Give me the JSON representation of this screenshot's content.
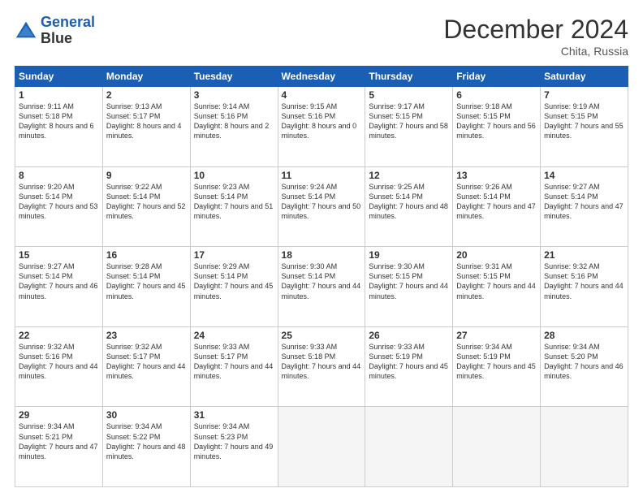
{
  "header": {
    "logo_line1": "General",
    "logo_line2": "Blue",
    "month": "December 2024",
    "location": "Chita, Russia"
  },
  "weekdays": [
    "Sunday",
    "Monday",
    "Tuesday",
    "Wednesday",
    "Thursday",
    "Friday",
    "Saturday"
  ],
  "weeks": [
    [
      {
        "day": "1",
        "sunrise": "Sunrise: 9:11 AM",
        "sunset": "Sunset: 5:18 PM",
        "daylight": "Daylight: 8 hours and 6 minutes."
      },
      {
        "day": "2",
        "sunrise": "Sunrise: 9:13 AM",
        "sunset": "Sunset: 5:17 PM",
        "daylight": "Daylight: 8 hours and 4 minutes."
      },
      {
        "day": "3",
        "sunrise": "Sunrise: 9:14 AM",
        "sunset": "Sunset: 5:16 PM",
        "daylight": "Daylight: 8 hours and 2 minutes."
      },
      {
        "day": "4",
        "sunrise": "Sunrise: 9:15 AM",
        "sunset": "Sunset: 5:16 PM",
        "daylight": "Daylight: 8 hours and 0 minutes."
      },
      {
        "day": "5",
        "sunrise": "Sunrise: 9:17 AM",
        "sunset": "Sunset: 5:15 PM",
        "daylight": "Daylight: 7 hours and 58 minutes."
      },
      {
        "day": "6",
        "sunrise": "Sunrise: 9:18 AM",
        "sunset": "Sunset: 5:15 PM",
        "daylight": "Daylight: 7 hours and 56 minutes."
      },
      {
        "day": "7",
        "sunrise": "Sunrise: 9:19 AM",
        "sunset": "Sunset: 5:15 PM",
        "daylight": "Daylight: 7 hours and 55 minutes."
      }
    ],
    [
      {
        "day": "8",
        "sunrise": "Sunrise: 9:20 AM",
        "sunset": "Sunset: 5:14 PM",
        "daylight": "Daylight: 7 hours and 53 minutes."
      },
      {
        "day": "9",
        "sunrise": "Sunrise: 9:22 AM",
        "sunset": "Sunset: 5:14 PM",
        "daylight": "Daylight: 7 hours and 52 minutes."
      },
      {
        "day": "10",
        "sunrise": "Sunrise: 9:23 AM",
        "sunset": "Sunset: 5:14 PM",
        "daylight": "Daylight: 7 hours and 51 minutes."
      },
      {
        "day": "11",
        "sunrise": "Sunrise: 9:24 AM",
        "sunset": "Sunset: 5:14 PM",
        "daylight": "Daylight: 7 hours and 50 minutes."
      },
      {
        "day": "12",
        "sunrise": "Sunrise: 9:25 AM",
        "sunset": "Sunset: 5:14 PM",
        "daylight": "Daylight: 7 hours and 48 minutes."
      },
      {
        "day": "13",
        "sunrise": "Sunrise: 9:26 AM",
        "sunset": "Sunset: 5:14 PM",
        "daylight": "Daylight: 7 hours and 47 minutes."
      },
      {
        "day": "14",
        "sunrise": "Sunrise: 9:27 AM",
        "sunset": "Sunset: 5:14 PM",
        "daylight": "Daylight: 7 hours and 47 minutes."
      }
    ],
    [
      {
        "day": "15",
        "sunrise": "Sunrise: 9:27 AM",
        "sunset": "Sunset: 5:14 PM",
        "daylight": "Daylight: 7 hours and 46 minutes."
      },
      {
        "day": "16",
        "sunrise": "Sunrise: 9:28 AM",
        "sunset": "Sunset: 5:14 PM",
        "daylight": "Daylight: 7 hours and 45 minutes."
      },
      {
        "day": "17",
        "sunrise": "Sunrise: 9:29 AM",
        "sunset": "Sunset: 5:14 PM",
        "daylight": "Daylight: 7 hours and 45 minutes."
      },
      {
        "day": "18",
        "sunrise": "Sunrise: 9:30 AM",
        "sunset": "Sunset: 5:14 PM",
        "daylight": "Daylight: 7 hours and 44 minutes."
      },
      {
        "day": "19",
        "sunrise": "Sunrise: 9:30 AM",
        "sunset": "Sunset: 5:15 PM",
        "daylight": "Daylight: 7 hours and 44 minutes."
      },
      {
        "day": "20",
        "sunrise": "Sunrise: 9:31 AM",
        "sunset": "Sunset: 5:15 PM",
        "daylight": "Daylight: 7 hours and 44 minutes."
      },
      {
        "day": "21",
        "sunrise": "Sunrise: 9:32 AM",
        "sunset": "Sunset: 5:16 PM",
        "daylight": "Daylight: 7 hours and 44 minutes."
      }
    ],
    [
      {
        "day": "22",
        "sunrise": "Sunrise: 9:32 AM",
        "sunset": "Sunset: 5:16 PM",
        "daylight": "Daylight: 7 hours and 44 minutes."
      },
      {
        "day": "23",
        "sunrise": "Sunrise: 9:32 AM",
        "sunset": "Sunset: 5:17 PM",
        "daylight": "Daylight: 7 hours and 44 minutes."
      },
      {
        "day": "24",
        "sunrise": "Sunrise: 9:33 AM",
        "sunset": "Sunset: 5:17 PM",
        "daylight": "Daylight: 7 hours and 44 minutes."
      },
      {
        "day": "25",
        "sunrise": "Sunrise: 9:33 AM",
        "sunset": "Sunset: 5:18 PM",
        "daylight": "Daylight: 7 hours and 44 minutes."
      },
      {
        "day": "26",
        "sunrise": "Sunrise: 9:33 AM",
        "sunset": "Sunset: 5:19 PM",
        "daylight": "Daylight: 7 hours and 45 minutes."
      },
      {
        "day": "27",
        "sunrise": "Sunrise: 9:34 AM",
        "sunset": "Sunset: 5:19 PM",
        "daylight": "Daylight: 7 hours and 45 minutes."
      },
      {
        "day": "28",
        "sunrise": "Sunrise: 9:34 AM",
        "sunset": "Sunset: 5:20 PM",
        "daylight": "Daylight: 7 hours and 46 minutes."
      }
    ],
    [
      {
        "day": "29",
        "sunrise": "Sunrise: 9:34 AM",
        "sunset": "Sunset: 5:21 PM",
        "daylight": "Daylight: 7 hours and 47 minutes."
      },
      {
        "day": "30",
        "sunrise": "Sunrise: 9:34 AM",
        "sunset": "Sunset: 5:22 PM",
        "daylight": "Daylight: 7 hours and 48 minutes."
      },
      {
        "day": "31",
        "sunrise": "Sunrise: 9:34 AM",
        "sunset": "Sunset: 5:23 PM",
        "daylight": "Daylight: 7 hours and 49 minutes."
      },
      null,
      null,
      null,
      null
    ]
  ]
}
